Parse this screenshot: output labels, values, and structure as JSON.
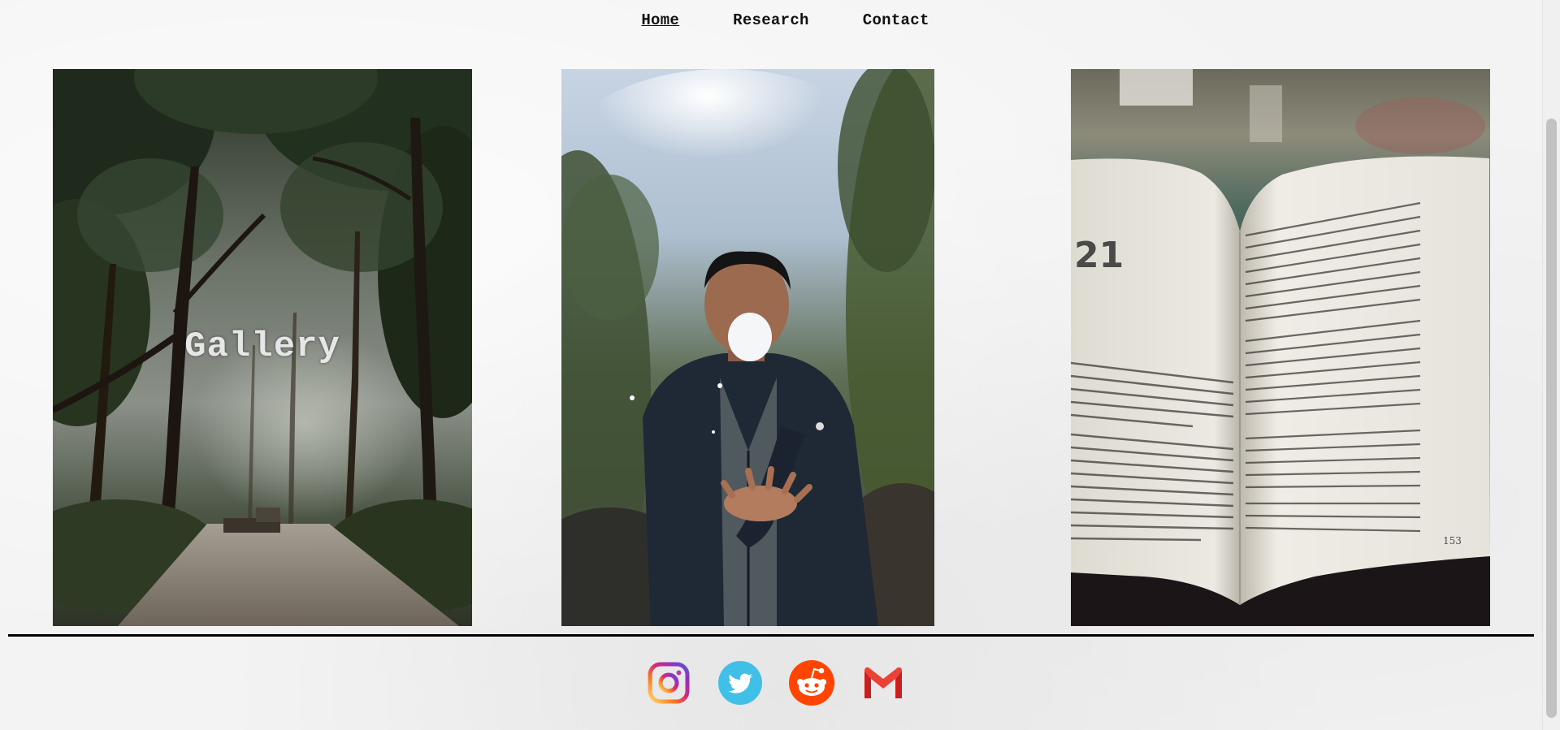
{
  "nav": {
    "items": [
      {
        "label": "Home",
        "active": true
      },
      {
        "label": "Research",
        "active": false
      },
      {
        "label": "Contact",
        "active": false
      }
    ]
  },
  "gallery": {
    "title": "Gallery",
    "photos": [
      {
        "subject": "forest path with trees"
      },
      {
        "subject": "person in jacket with outstretched hand"
      },
      {
        "subject": "open book held in hand"
      }
    ],
    "book": {
      "page_number_left": "21",
      "page_number_right": "153"
    }
  },
  "social": {
    "links": [
      {
        "icon": "instagram-icon",
        "color": "#e1306c"
      },
      {
        "icon": "twitter-icon",
        "color": "#40c0e7"
      },
      {
        "icon": "reddit-icon",
        "color": "#ff4500"
      },
      {
        "icon": "gmail-icon",
        "color": "#d93025"
      }
    ]
  }
}
